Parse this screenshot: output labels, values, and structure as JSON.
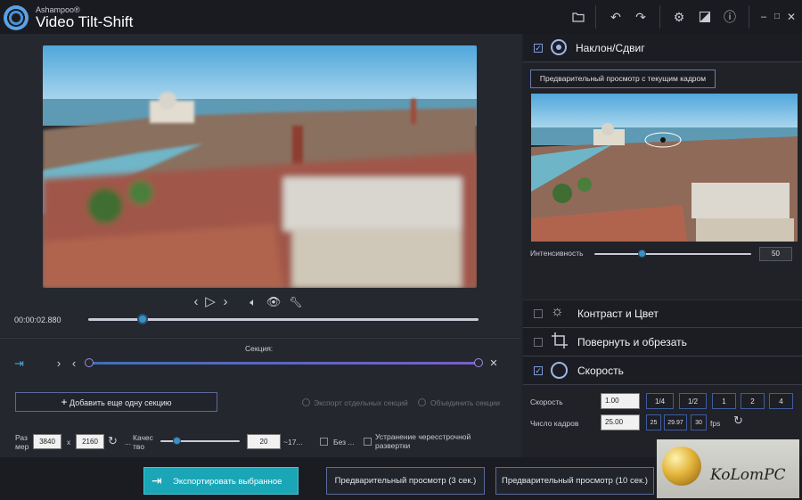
{
  "app": {
    "brand": "Ashampoo®",
    "title": "Video Tilt-Shift"
  },
  "player": {
    "timecode": "00:00:02.880",
    "progress": 0.14
  },
  "section": {
    "label": "Секция:",
    "add_button": "Добавить еще одну секцию",
    "export_separate": "Экспорт отдельных секций",
    "merge": "Объединить секции"
  },
  "output": {
    "size_label_1": "Раз",
    "size_label_2": "мер",
    "width": "3840",
    "x": "x",
    "height": "2160",
    "ellipsis": "...",
    "quality_label_1": "Качес",
    "quality_label_2": "тво",
    "quality": "20",
    "quality_suffix": "~17...",
    "no_label": "Без ...",
    "deinterlace_1": "Устранение чересстрочной",
    "deinterlace_2": "развертки"
  },
  "bottom": {
    "export": "Экспортировать выбранное",
    "preview3": "Предварительный просмотр (3 сек.)",
    "preview10": "Предварительный просмотр (10 сек.)"
  },
  "tilt": {
    "title": "Наклон/Сдвиг",
    "preview_btn": "Предварительный просмотр с текущим кадром",
    "intensity_label": "Интенсивность",
    "intensity": "50",
    "intensity_level": 0.3
  },
  "panels": {
    "contrast": "Контраст и Цвет",
    "rotate": "Повернуть и обрезать",
    "speed": "Скорость"
  },
  "speed": {
    "speed_label": "Скорость",
    "speed_value": "1.00",
    "presets": [
      "1/4",
      "1/2",
      "1",
      "2",
      "4"
    ],
    "fps_label": "Число кадров",
    "fps_value": "25.00",
    "fps_presets": [
      "25",
      "29.97",
      "30"
    ],
    "fps_unit": "fps"
  },
  "watermark": {
    "text": "KoLomPC"
  },
  "colors": {
    "accent": "#3b8fc7",
    "export_button": "#1aa6b7"
  }
}
